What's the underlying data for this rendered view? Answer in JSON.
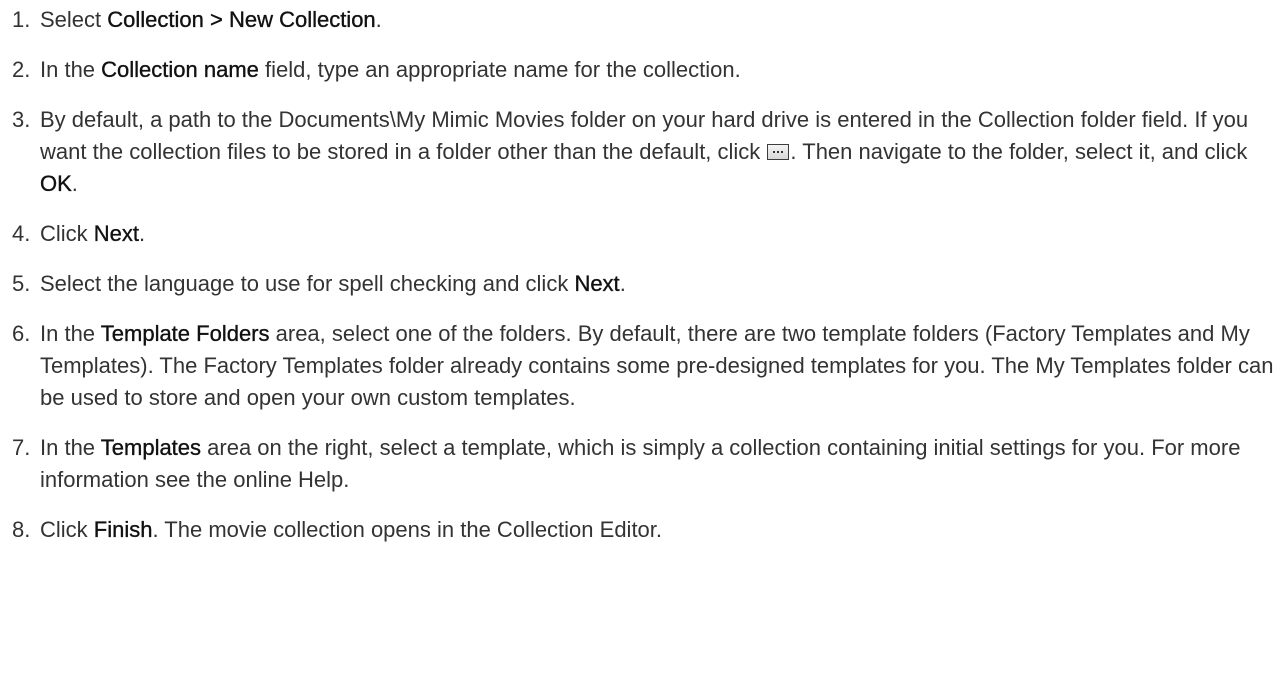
{
  "steps": [
    {
      "num": "1.",
      "parts": [
        {
          "t": "Select "
        },
        {
          "t": "Collection > New Collection",
          "b": true
        },
        {
          "t": "."
        }
      ]
    },
    {
      "num": "2.",
      "parts": [
        {
          "t": "In the "
        },
        {
          "t": "Collection name",
          "b": true
        },
        {
          "t": " field, type an appropriate name for the collection."
        }
      ]
    },
    {
      "num": "3.",
      "parts": [
        {
          "t": "By default, a path to the Documents\\My Mimic Movies folder on your hard drive is entered in the Collection folder field. If you want the collection files to be stored in a folder other than the default, click "
        },
        {
          "icon": "browse-button-icon"
        },
        {
          "t": ". Then navigate to the folder, select it, and click "
        },
        {
          "t": "OK",
          "b": true
        },
        {
          "t": "."
        }
      ]
    },
    {
      "num": "4.",
      "parts": [
        {
          "t": "Click "
        },
        {
          "t": "Next",
          "b": true
        },
        {
          "t": "."
        }
      ]
    },
    {
      "num": "5.",
      "parts": [
        {
          "t": "Select the language to use for spell checking and click "
        },
        {
          "t": "Next",
          "b": true
        },
        {
          "t": "."
        }
      ]
    },
    {
      "num": "6.",
      "parts": [
        {
          "t": "In the "
        },
        {
          "t": "Template Folders",
          "b": true
        },
        {
          "t": " area, select one of the folders. By default, there are two template folders (Factory Templates and My Templates). The Factory Templates folder already contains some pre-designed templates for you. The My Templates folder can be used to store and open your own custom templates."
        }
      ]
    },
    {
      "num": "7.",
      "parts": [
        {
          "t": "In the "
        },
        {
          "t": "Templates",
          "b": true
        },
        {
          "t": " area on the right, select a template, which is simply a collection containing initial settings for you. For more information see the online Help."
        }
      ]
    },
    {
      "num": "8.",
      "parts": [
        {
          "t": "Click "
        },
        {
          "t": "Finish",
          "b": true
        },
        {
          "t": ". The movie collection opens in the Collection Editor."
        }
      ]
    }
  ]
}
